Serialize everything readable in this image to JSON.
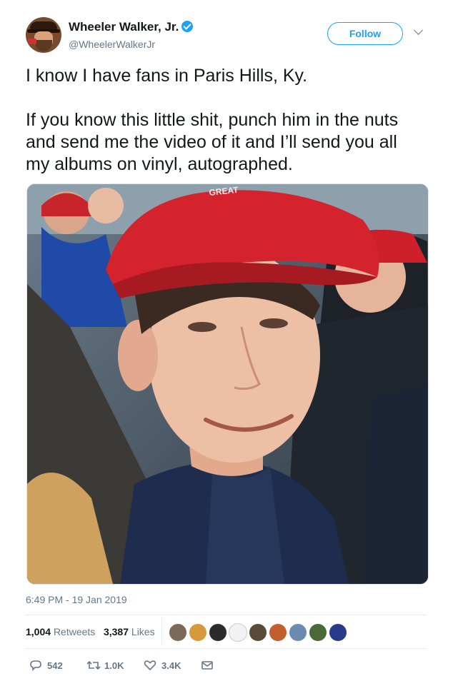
{
  "tweet": {
    "author_name": "Wheeler Walker, Jr.",
    "handle": "@WheelerWalkerJr",
    "follow_label": "Follow",
    "text": "I know I have fans in Paris Hills, Ky.\n\nIf you know this little shit, punch him in the nuts and send me the video of it and I’ll send you all my albums on vinyl, autographed.",
    "timestamp": "6:49 PM - 19 Jan 2019"
  },
  "photo": {
    "hat_text": "GREAT"
  },
  "stats": {
    "retweets_count": "1,004",
    "retweets_label": "Retweets",
    "likes_count": "3,387",
    "likes_label": "Likes"
  },
  "actions": {
    "replies": "542",
    "retweets": "1.0K",
    "likes": "3.4K"
  },
  "colors": {
    "accent": "#1da1f2",
    "text": "#14171a",
    "muted": "#657786"
  }
}
